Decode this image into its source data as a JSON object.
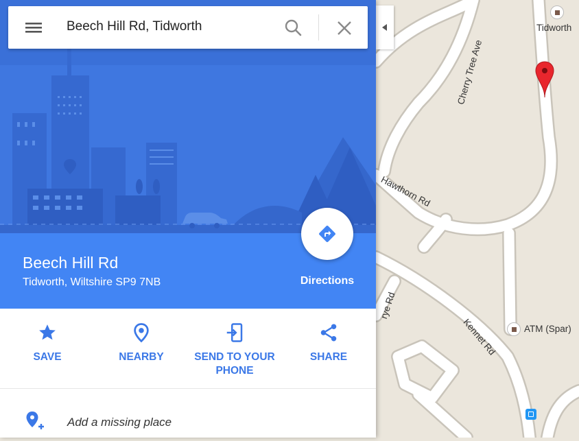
{
  "search": {
    "query": "Beech Hill Rd, Tidworth"
  },
  "place": {
    "title": "Beech Hill Rd",
    "address": "Tidworth, Wiltshire SP9 7NB"
  },
  "directions": {
    "label": "Directions"
  },
  "actions": [
    {
      "label": "SAVE",
      "icon": "star-icon"
    },
    {
      "label": "NEARBY",
      "icon": "nearby-pin-icon"
    },
    {
      "label_line1": "SEND TO YOUR",
      "label_line2": "PHONE",
      "icon": "send-to-phone-icon"
    },
    {
      "label": "SHARE",
      "icon": "share-icon"
    }
  ],
  "add_place": {
    "label": "Add a missing place",
    "icon": "add-location-icon"
  },
  "map": {
    "labels": {
      "tidworth": "Tidworth",
      "cherry_tree": "Cherry Tree Ave",
      "hawthorn": "Hawthorn Rd",
      "kennet": "Kennet Rd",
      "atm": "ATM (Spar)",
      "partial_road": "rye Rd"
    }
  },
  "colors": {
    "accent": "#4285f4",
    "hero": "#3f77e0",
    "map_bg": "#ebe6dc",
    "marker": "#e8262d",
    "action_text": "#3b78e7"
  }
}
